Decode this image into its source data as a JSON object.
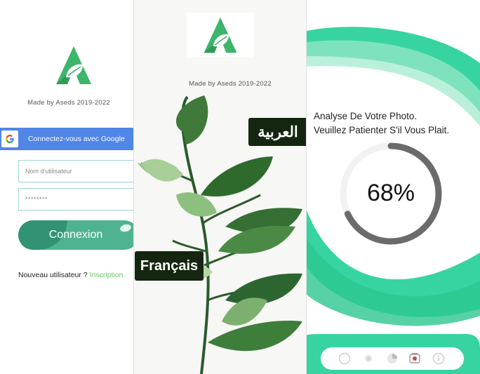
{
  "login": {
    "credit": "Made by Aseds 2019-2022",
    "google_button": "Connectez-vous avec Google",
    "username_placeholder": "Nom d'utilisateur",
    "password_placeholder": "********",
    "submit_label": "Connexion",
    "new_user_prefix": "Nouveau utilisateur ? ",
    "signup_link": "Inscription"
  },
  "language": {
    "credit": "Made by Aseds 2019-2022",
    "arabic_option": "العربية",
    "french_option": "Français"
  },
  "analysis": {
    "line1": "Analyse De Votre Photo.",
    "line2": "Veuillez Patienter S'il Vous Plait.",
    "progress_text": "68%",
    "progress_value": 0.68
  },
  "colors": {
    "brand_green": "#3db56a",
    "teal": "#39d2a4",
    "google_blue": "#4f86e8",
    "button_green": "#4fb392",
    "label_dark": "#152610",
    "progress_gray": "#6b6b6b",
    "link_green": "#6ac66a"
  },
  "icons": [
    "app-logo-icon",
    "google-g-icon",
    "nav-home-icon",
    "nav-dot-icon",
    "nav-chart-icon",
    "nav-photo-icon",
    "nav-info-icon"
  ]
}
